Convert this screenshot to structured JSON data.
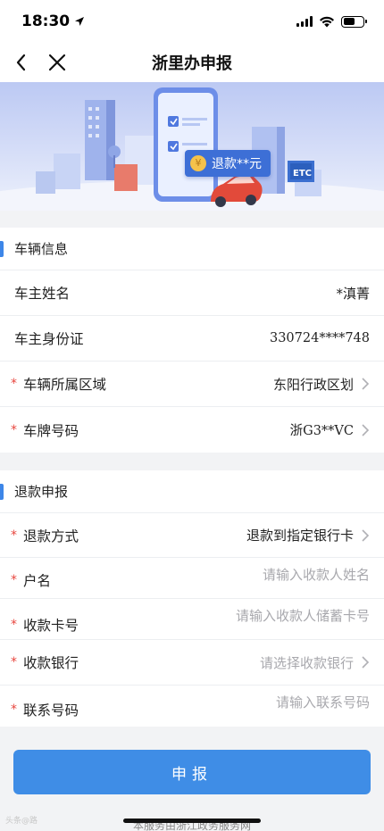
{
  "status_bar": {
    "time": "18:30"
  },
  "nav": {
    "title": "浙里办申报"
  },
  "banner": {
    "refund_badge": "退款**元",
    "etc_label": "ETC"
  },
  "vehicle_section": {
    "title": "车辆信息",
    "rows": [
      {
        "label": "车主姓名",
        "value": "*滇菁"
      },
      {
        "label": "车主身份证",
        "value": "330724****748"
      },
      {
        "label": "车辆所属区域",
        "value": "东阳行政区划"
      },
      {
        "label": "车牌号码",
        "value": "浙G3**VC"
      }
    ]
  },
  "refund_section": {
    "title": "退款申报",
    "rows": [
      {
        "label": "退款方式",
        "value": "退款到指定银行卡"
      },
      {
        "label": "户名",
        "placeholder": "请输入收款人姓名"
      },
      {
        "label": "收款卡号",
        "placeholder": "请输入收款人储蓄卡号"
      },
      {
        "label": "收款银行",
        "placeholder": "请选择收款银行"
      },
      {
        "label": "联系号码",
        "placeholder": "请输入联系号码"
      }
    ]
  },
  "required_mark": "*",
  "submit": {
    "label": "申报"
  },
  "footer": {
    "note": "本服务由浙江政务服务网"
  },
  "watermark": "头条@路",
  "colors": {
    "accent": "#3f8de6",
    "required": "#e8463e",
    "placeholder": "#a8a8ad"
  }
}
